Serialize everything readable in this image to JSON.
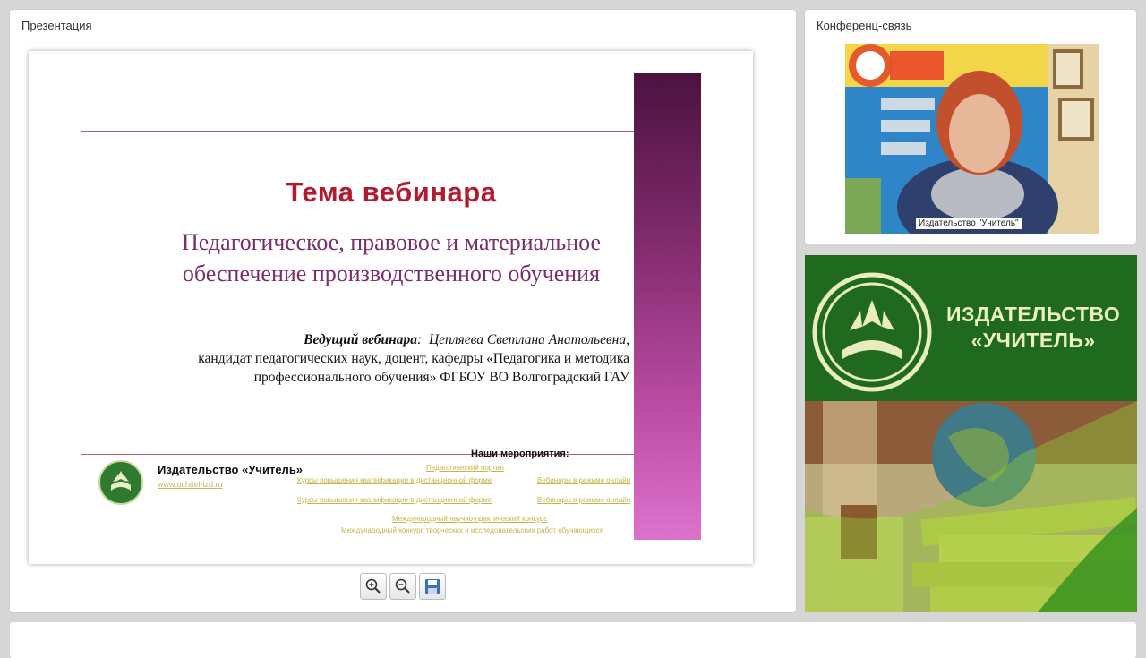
{
  "presentation": {
    "title": "Презентация",
    "slide": {
      "heading": "Тема вебинара",
      "subtitle_line1": "Педагогическое, правовое и материальное",
      "subtitle_line2": "обеспечение производственного обучения",
      "host_label": "Ведущий вебинара",
      "host_name": "Цепляева Светлана Анатольевна,",
      "host_line2": "кандидат педагогических наук,  доцент, кафедры «Педагогика и методика",
      "host_line3": "профессионального обучения» ФГБОУ ВО Волгоградский ГАУ",
      "publisher": "Издательство «Учитель»",
      "publisher_url": "www.uchitel-izd.ru",
      "events_title": "Наши мероприятия:",
      "events": [
        "Педагогический портал",
        "Курсы повышения квалификации в дистанционной форме",
        "Вебинары в режиме онлайн",
        "Курсы повышения квалификации в дистанционной форме",
        "Вебинары в режиме онлайн",
        "Международный научно-практический конкурс",
        "Международный конкурс творческих и исследовательских работ обучающихся"
      ]
    },
    "tools": {
      "zoom_in": "zoom-in-icon",
      "zoom_out": "zoom-out-icon",
      "save": "save-icon"
    }
  },
  "conference": {
    "title": "Конференц-связь",
    "video_label": "Издательство \"Учитель\""
  },
  "banner": {
    "line1": "ИЗДАТЕЛЬСТВО",
    "line2": "«УЧИТЕЛЬ»"
  },
  "colors": {
    "slide_accent": "#b5192f",
    "subtitle": "#7b2e6d",
    "banner_green": "#1f6a1e"
  }
}
